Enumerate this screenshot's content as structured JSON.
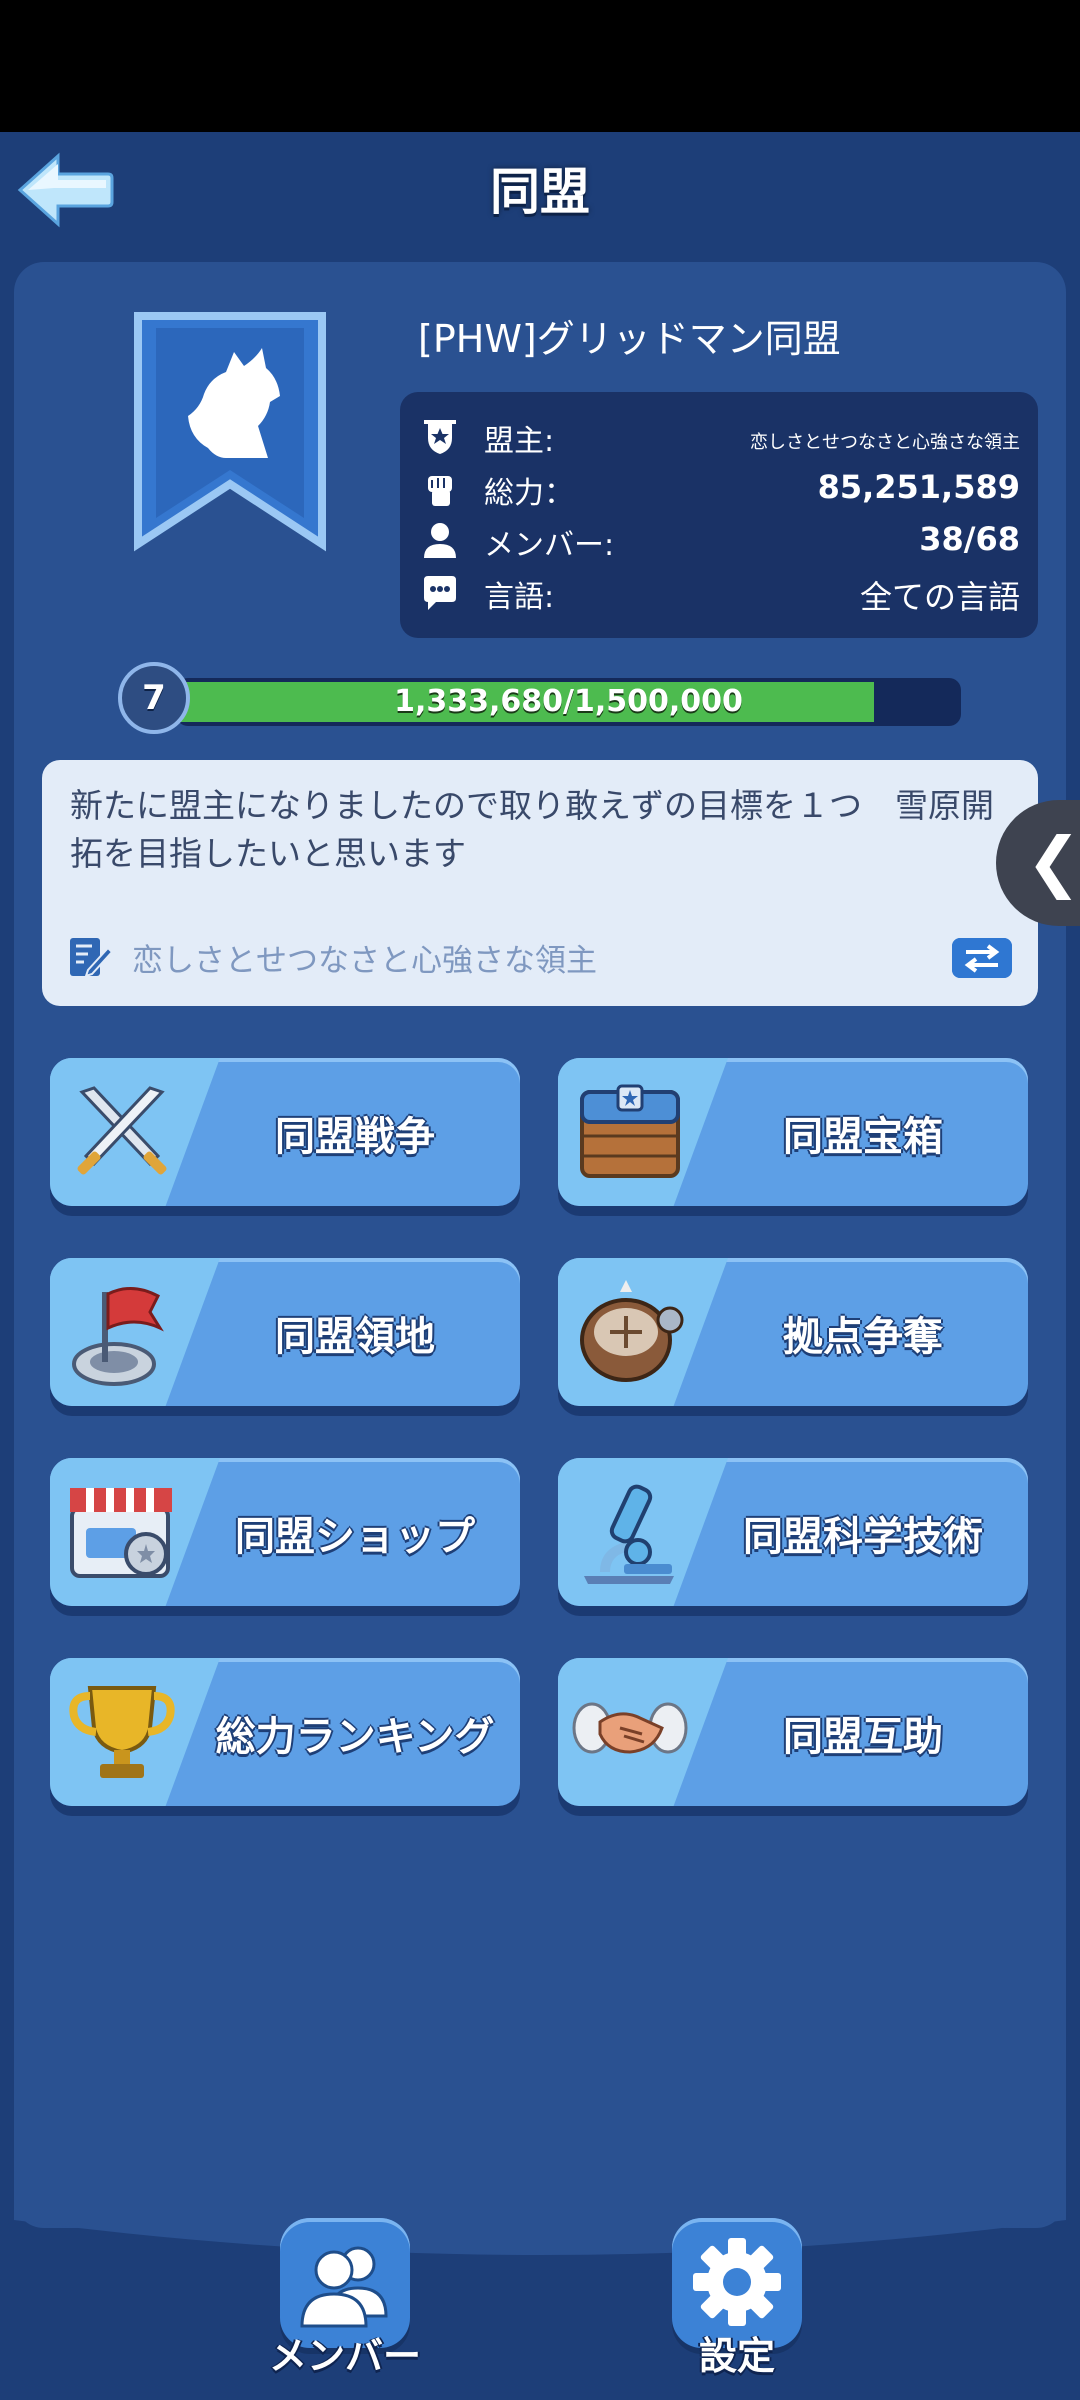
{
  "header": {
    "title": "同盟",
    "back_icon": "back-arrow-icon"
  },
  "alliance": {
    "name": "[PHW]グリッドマン同盟",
    "emblem_icon": "wolf-banner-icon",
    "info": [
      {
        "icon": "shield-icon",
        "label": "盟主:",
        "value": "恋しさとせつなさと心強さな領主"
      },
      {
        "icon": "fist-icon",
        "label": "総力：",
        "value": "85,251,589"
      },
      {
        "icon": "member-icon",
        "label": "メンバー:",
        "value": "38/68"
      },
      {
        "icon": "chat-icon",
        "label": "言語:",
        "value": "全ての言語"
      }
    ],
    "level": "7",
    "xp_text": "1,333,680/1,500,000",
    "xp_fraction": 0.889
  },
  "notice": {
    "text": "新たに盟主になりましたので取り敢えずの目標を１つ　雪原開拓を目指したいと思います",
    "author": "恋しさとせつなさと心強さな領主",
    "edit_icon": "edit-icon",
    "switch_icon": "swap-icon"
  },
  "side_tab": {
    "glyph": "❮"
  },
  "menu": [
    {
      "label": "同盟戦争",
      "icon": "crossed-swords-icon"
    },
    {
      "label": "同盟宝箱",
      "icon": "treasure-chest-icon"
    },
    {
      "label": "同盟領地",
      "icon": "red-flag-icon"
    },
    {
      "label": "拠点争奪",
      "icon": "fortress-icon"
    },
    {
      "label": "同盟ショップ",
      "icon": "shop-icon"
    },
    {
      "label": "同盟科学技術",
      "icon": "microscope-icon"
    },
    {
      "label": "総力ランキング",
      "icon": "trophy-icon"
    },
    {
      "label": "同盟互助",
      "icon": "handshake-icon"
    }
  ],
  "bottom_nav": {
    "members_label": "メンバー",
    "settings_label": "設定"
  },
  "colors": {
    "background": "#1d3e78",
    "panel": "#2a5191",
    "button": "#5d9fe6",
    "xp_fill": "#4dbb4f"
  }
}
